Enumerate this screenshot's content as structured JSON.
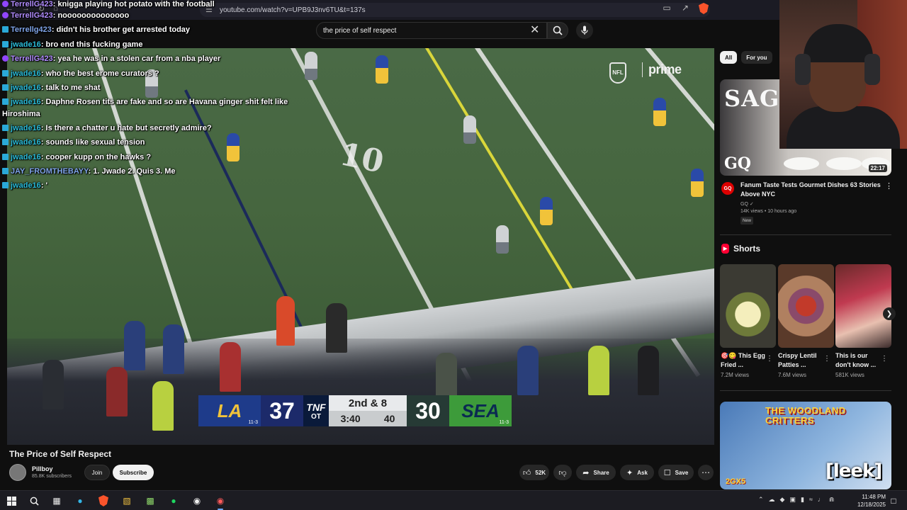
{
  "browser": {
    "url": "youtube.com/watch?v=UPB9J3nv6TU&t=137s"
  },
  "search": {
    "query": "the price of self respect"
  },
  "chat": [
    {
      "user": "TerrellG423",
      "msg": ": knigga playing hot potato with the football",
      "color": "purple"
    },
    {
      "user": "TerrellG423",
      "msg": ": noooooooooooooo",
      "color": "purple"
    },
    {
      "user": "Terrellg423",
      "msg": ": didn't his brother get arrested today",
      "color": "blue2"
    },
    {
      "user": "jwade16",
      "msg": ": bro end this fucking game",
      "color": "cyan"
    },
    {
      "user": "TerrellG423",
      "msg": ": yea he was in a stolen car from a nba player",
      "color": "purple"
    },
    {
      "user": "jwade16",
      "msg": ": who the best erome curators ?",
      "color": "cyan"
    },
    {
      "user": "jwade16",
      "msg": ": talk to me shat",
      "color": "cyan"
    },
    {
      "user": "jwade16",
      "msg": ": Daphne Rosen tits are fake and so are Havana ginger shit felt like",
      "color": "cyan"
    },
    {
      "user": "",
      "msg": "Hiroshima",
      "color": "none"
    },
    {
      "user": "jwade16",
      "msg": ": Is there a chatter u hate but secretly admire?",
      "color": "cyan"
    },
    {
      "user": "jwade16",
      "msg": ": sounds like sexual tension",
      "color": "cyan"
    },
    {
      "user": "jwade16",
      "msg": ": cooper kupp on the hawks ?",
      "color": "cyan"
    },
    {
      "user": "JAY_FROMTHEBAYY",
      "msg": ": 1. Jwade 2. Quis 3. Me",
      "color": "blue2"
    },
    {
      "user": "jwade16",
      "msg": ": '",
      "color": "cyan"
    }
  ],
  "broadcast": {
    "network_logo": "NFL",
    "streamer": "prime",
    "home_score": "37",
    "home_record": "11-3",
    "away_score": "30",
    "away_record": "11-3",
    "network": "TNF",
    "period": "OT",
    "down_distance": "2nd & 8",
    "game_clock": "3:40",
    "play_clock": "40",
    "field_numbers": [
      "10"
    ]
  },
  "video": {
    "title": "The Price of Self Respect",
    "channel": "Pillboy",
    "subscribers": "85.8K subscribers",
    "join_label": "Join",
    "subscribe_label": "Subscribe",
    "likes": "52K",
    "share_label": "Share",
    "ask_label": "Ask",
    "save_label": "Save"
  },
  "sidebar": {
    "chips": [
      "All",
      "For you"
    ],
    "recommended": {
      "thumb_text_top": "SAGA",
      "thumb_text_brand": "GQ",
      "duration": "22:17",
      "title": "Fanum Taste Tests Gourmet Dishes 63 Stories Above NYC",
      "channel": "GQ",
      "meta": "14K views • 10 hours ago",
      "badge": "New"
    },
    "shorts_heading": "Shorts",
    "shorts": [
      {
        "title": "🎯😋 This Egg Fried ...",
        "views": "7.2M views"
      },
      {
        "title": "Crispy Lentil Patties ...",
        "views": "7.6M views"
      },
      {
        "title": "This is our don't know ...",
        "views": "581K views"
      }
    ],
    "promo_title": "THE WOODLAND CRITTERS",
    "promo_badge": "2GX5"
  },
  "overlay": {
    "watermark": "[leek]"
  },
  "taskbar": {
    "time": "11:48 PM",
    "date": "12/18/2025"
  },
  "colors": {
    "accent_red": "#ff0033",
    "chat_cyan": "#2bbcd8",
    "chat_purple": "#b18cff",
    "rams_blue": "#1e3b8a",
    "hawks_green": "#3d9b3a"
  }
}
